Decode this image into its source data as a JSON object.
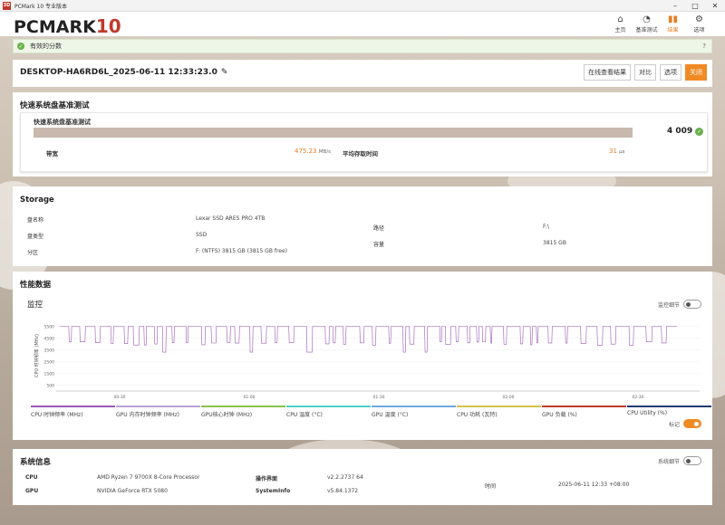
{
  "window": {
    "app_icon": "3D",
    "title": "PCMark 10 专业版本"
  },
  "logo": {
    "text": "PCMARK",
    "num": "10"
  },
  "nav": [
    {
      "icon": "⌂",
      "label": "主页",
      "active": false
    },
    {
      "icon": "◔",
      "label": "基准测试",
      "active": false
    },
    {
      "icon": "▮▮",
      "label": "结果",
      "active": true
    },
    {
      "icon": "⚙",
      "label": "选项",
      "active": false
    }
  ],
  "notice": {
    "text": "有效的分数",
    "close": "?"
  },
  "result": {
    "title": "DESKTOP-HA6RD6L_2025-06-11 12:33:23.0",
    "buttons": {
      "online": "在线查看结果",
      "compare": "对比",
      "options": "选项",
      "close": "关闭"
    }
  },
  "quick": {
    "section_title": "快速系统盘基准测试",
    "card_title": "快速系统盘基准测试",
    "score": "4 009",
    "bandwidth_label": "带宽",
    "bandwidth_value": "475.23",
    "bandwidth_unit": "MB/s",
    "access_label": "平均存取时间",
    "access_value": "31",
    "access_unit": "μs"
  },
  "storage": {
    "section_title": "Storage",
    "disk_name_label": "盘名称",
    "disk_name": "Lexar SSD ARES PRO 4TB",
    "disk_type_label": "盘类型",
    "disk_type": "SSD",
    "partition_label": "分区",
    "partition": "F: (NTFS) 3815 GB (3815 GB free)",
    "path_label": "路径",
    "path": "F:\\",
    "capacity_label": "容量",
    "capacity": "3815 GB"
  },
  "perf": {
    "section_title": "性能数据",
    "monitor_title": "监控",
    "monitor_detail": "监控细节",
    "marker": "标记",
    "y_label": "CPU 时钟频率 (MHz)",
    "y_ticks": [
      "5500",
      "4500",
      "3500",
      "2500",
      "1500",
      "500"
    ],
    "x_ticks": [
      "00:30",
      "01:00",
      "01:30",
      "02:00",
      "02:30"
    ],
    "legend": [
      {
        "label": "CPU 时钟频率 (MHz)",
        "color": "#9b59b6"
      },
      {
        "label": "GPU 内存时钟频率 (MHz)",
        "color": "#b9a3d6"
      },
      {
        "label": "GPU核心时钟 (MHz)",
        "color": "#8bc34a"
      },
      {
        "label": "CPU 温度 (°C)",
        "color": "#4dd0c5"
      },
      {
        "label": "GPU 温度 (°C)",
        "color": "#6fa8dc"
      },
      {
        "label": "CPU 功耗 (瓦特)",
        "color": "#d4c24a"
      },
      {
        "label": "GPU 负载 (%)",
        "color": "#c0392b"
      },
      {
        "label": "CPU Utility (%)",
        "color": "#1f3b73"
      }
    ]
  },
  "chart_data": {
    "type": "line",
    "title": "",
    "xlabel": "",
    "ylabel": "CPU 时钟频率 (MHz)",
    "ylim": [
      0,
      6000
    ],
    "x_ticks": [
      "00:30",
      "01:00",
      "01:30",
      "02:00",
      "02:30"
    ],
    "series": [
      {
        "name": "CPU 时钟频率 (MHz)",
        "high": 5500,
        "low": 4200
      }
    ]
  },
  "sysinfo": {
    "section_title": "系统信息",
    "detail": "系统细节",
    "cpu_label": "CPU",
    "cpu": "AMD Ryzen 7 9700X 8-Core Processor",
    "gpu_label": "GPU",
    "gpu": "NVIDIA GeForce RTX 5080",
    "os_label": "操作界面",
    "os": "v2.2.2737 64",
    "si_label": "SystemInfo",
    "si": "v5.84.1372",
    "time_label": "时间",
    "time": "2025-06-11 12:33 +08:00"
  }
}
